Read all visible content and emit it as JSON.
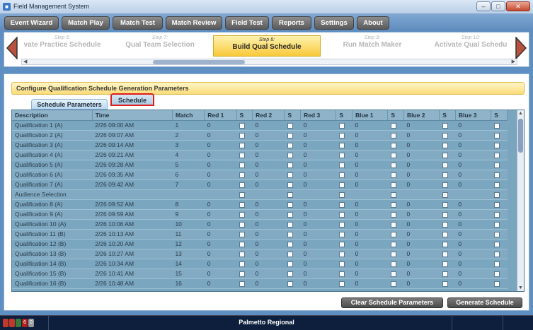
{
  "window": {
    "title": "Field Management System"
  },
  "menu": [
    {
      "label": "Event Wizard"
    },
    {
      "label": "Match Play"
    },
    {
      "label": "Match Test"
    },
    {
      "label": "Match Review"
    },
    {
      "label": "Field Test"
    },
    {
      "label": "Reports"
    },
    {
      "label": "Settings"
    },
    {
      "label": "About"
    }
  ],
  "stepper": {
    "steps": [
      {
        "num": "Step 6:",
        "label": "vate Practice Schedule"
      },
      {
        "num": "Step 7:",
        "label": "Qual Team Selection"
      },
      {
        "num": "Step 8:",
        "label": "Build Qual Schedule"
      },
      {
        "num": "Step 9:",
        "label": "Run Match Maker"
      },
      {
        "num": "Step 10:",
        "label": "Activate Qual Schedu"
      }
    ],
    "active_index": 2
  },
  "config": {
    "heading": "Configure Qualification Schedule Generation Parameters"
  },
  "tabs": {
    "params": "Schedule Parameters",
    "schedule": "Schedule"
  },
  "table": {
    "headers": [
      "Description",
      "Time",
      "Match",
      "Red 1",
      "S",
      "Red 2",
      "S",
      "Red 3",
      "S",
      "Blue 1",
      "S",
      "Blue 2",
      "S",
      "Blue 3",
      "S"
    ],
    "rows": [
      {
        "desc": "Qualification 1 (A)",
        "time": "2/26 09:00 AM",
        "match": "1",
        "r1": "0",
        "r2": "0",
        "r3": "0",
        "b1": "0",
        "b2": "0",
        "b3": "0"
      },
      {
        "desc": "Qualification 2 (A)",
        "time": "2/26 09:07 AM",
        "match": "2",
        "r1": "0",
        "r2": "0",
        "r3": "0",
        "b1": "0",
        "b2": "0",
        "b3": "0"
      },
      {
        "desc": "Qualification 3 (A)",
        "time": "2/26 09:14 AM",
        "match": "3",
        "r1": "0",
        "r2": "0",
        "r3": "0",
        "b1": "0",
        "b2": "0",
        "b3": "0"
      },
      {
        "desc": "Qualification 4 (A)",
        "time": "2/26 09:21 AM",
        "match": "4",
        "r1": "0",
        "r2": "0",
        "r3": "0",
        "b1": "0",
        "b2": "0",
        "b3": "0"
      },
      {
        "desc": "Qualification 5 (A)",
        "time": "2/26 09:28 AM",
        "match": "5",
        "r1": "0",
        "r2": "0",
        "r3": "0",
        "b1": "0",
        "b2": "0",
        "b3": "0"
      },
      {
        "desc": "Qualification 6 (A)",
        "time": "2/26 09:35 AM",
        "match": "6",
        "r1": "0",
        "r2": "0",
        "r3": "0",
        "b1": "0",
        "b2": "0",
        "b3": "0"
      },
      {
        "desc": "Qualification 7 (A)",
        "time": "2/26 09:42 AM",
        "match": "7",
        "r1": "0",
        "r2": "0",
        "r3": "0",
        "b1": "0",
        "b2": "0",
        "b3": "0"
      },
      {
        "desc": "Audience Selection",
        "time": "",
        "match": "",
        "r1": "",
        "r2": "",
        "r3": "",
        "b1": "",
        "b2": "",
        "b3": ""
      },
      {
        "desc": "Qualification 8 (A)",
        "time": "2/26 09:52 AM",
        "match": "8",
        "r1": "0",
        "r2": "0",
        "r3": "0",
        "b1": "0",
        "b2": "0",
        "b3": "0"
      },
      {
        "desc": "Qualification 9 (A)",
        "time": "2/26 09:59 AM",
        "match": "9",
        "r1": "0",
        "r2": "0",
        "r3": "0",
        "b1": "0",
        "b2": "0",
        "b3": "0"
      },
      {
        "desc": "Qualification 10 (A)",
        "time": "2/26 10:06 AM",
        "match": "10",
        "r1": "0",
        "r2": "0",
        "r3": "0",
        "b1": "0",
        "b2": "0",
        "b3": "0"
      },
      {
        "desc": "Qualification 11 (B)",
        "time": "2/26 10:13 AM",
        "match": "11",
        "r1": "0",
        "r2": "0",
        "r3": "0",
        "b1": "0",
        "b2": "0",
        "b3": "0"
      },
      {
        "desc": "Qualification 12 (B)",
        "time": "2/26 10:20 AM",
        "match": "12",
        "r1": "0",
        "r2": "0",
        "r3": "0",
        "b1": "0",
        "b2": "0",
        "b3": "0"
      },
      {
        "desc": "Qualification 13 (B)",
        "time": "2/26 10:27 AM",
        "match": "13",
        "r1": "0",
        "r2": "0",
        "r3": "0",
        "b1": "0",
        "b2": "0",
        "b3": "0"
      },
      {
        "desc": "Qualification 14 (B)",
        "time": "2/26 10:34 AM",
        "match": "14",
        "r1": "0",
        "r2": "0",
        "r3": "0",
        "b1": "0",
        "b2": "0",
        "b3": "0"
      },
      {
        "desc": "Qualification 15 (B)",
        "time": "2/26 10:41 AM",
        "match": "15",
        "r1": "0",
        "r2": "0",
        "r3": "0",
        "b1": "0",
        "b2": "0",
        "b3": "0"
      },
      {
        "desc": "Qualification 16 (B)",
        "time": "2/26 10:48 AM",
        "match": "16",
        "r1": "0",
        "r2": "0",
        "r3": "0",
        "b1": "0",
        "b2": "0",
        "b3": "0"
      }
    ]
  },
  "actions": {
    "clear": "Clear Schedule Parameters",
    "generate": "Generate Schedule"
  },
  "status": {
    "venue": "Palmetto Regional",
    "lights": [
      {
        "color": "#c0392b",
        "text": ""
      },
      {
        "color": "#c0392b",
        "text": ""
      },
      {
        "color": "#3a7a3a",
        "text": ""
      },
      {
        "color": "#b02020",
        "text": "6"
      },
      {
        "color": "#9a9a9a",
        "text": "0"
      }
    ]
  },
  "colors": {
    "accent": "#f8c93a",
    "highlight": "#e01d1d",
    "menu_bg": "#6e6e6e"
  }
}
